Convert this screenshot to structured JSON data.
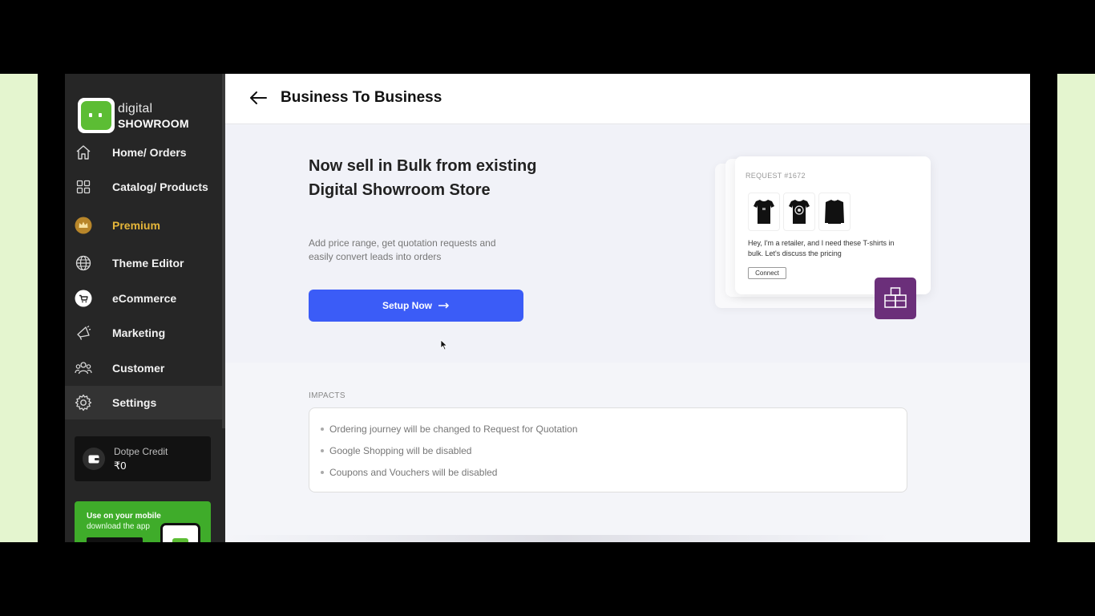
{
  "brand": {
    "line1": "digital",
    "line2": "SHOWROOM",
    "color": "#5cbd34"
  },
  "sidebar": {
    "items": [
      {
        "label": "Home/ Orders",
        "icon": "home-icon"
      },
      {
        "label": "Catalog/ Products",
        "icon": "grid-icon"
      },
      {
        "label": "Premium",
        "icon": "crown-icon",
        "color": "#e5b63a"
      },
      {
        "label": "Theme Editor",
        "icon": "globe-icon"
      },
      {
        "label": "eCommerce",
        "icon": "cart-icon"
      },
      {
        "label": "Marketing",
        "icon": "megaphone-icon"
      },
      {
        "label": "Customer",
        "icon": "users-icon"
      },
      {
        "label": "Settings",
        "icon": "gear-icon"
      }
    ],
    "credit": {
      "label": "Dotpe Credit",
      "value": "₹0",
      "icon": "wallet-icon"
    },
    "mobile_banner": {
      "line1": "Use on your mobile",
      "line2": "download the app"
    }
  },
  "header": {
    "title": "Business To Business",
    "back_icon": "arrow-left-icon"
  },
  "hero": {
    "title": "Now sell in Bulk from existing Digital Showroom Store",
    "description": "Add price range, get quotation requests and easily convert leads into orders",
    "cta_label": "Setup Now",
    "cta_color": "#3b5cf7"
  },
  "request_card": {
    "label": "REQUEST #1672",
    "message": "Hey, I'm a retailer, and I need these T-shirts in bulk. Let's discuss the pricing",
    "connect_label": "Connect",
    "badge_color": "#6b2f7a"
  },
  "impacts": {
    "label": "IMPACTS",
    "items": [
      "Ordering journey will be changed to Request for Quotation",
      "Google Shopping will be disabled",
      "Coupons and Vouchers will be disabled"
    ]
  }
}
